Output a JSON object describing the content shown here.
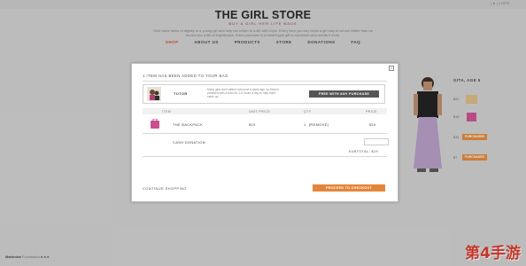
{
  "header": {
    "top_links": "| ●  |  LISTE",
    "logo_title": "THE GIRL STORE",
    "logo_subtitle": "BUY A GIRL HER LIFE BACK",
    "intro_text": "Give basic items of dignity to a young girl and help her return to a life with hope. Every item you buy helps a girl stay in school rather than be forced into a life of exploitation. Each purchase is a meaningful gift to someone who needs it most."
  },
  "nav": {
    "items": [
      "SHOP",
      "ABOUT US",
      "PRODUCTS",
      "STORE",
      "DONATIONS",
      "FAQ"
    ],
    "active_index": 0,
    "active_color": "#c4512b"
  },
  "product_side": {
    "girl_label": "GITA, AGE 5",
    "prices": [
      "$22",
      "$15",
      "$15",
      "$7"
    ],
    "badges": [
      "PURCHASED",
      "PURCHASED"
    ],
    "badge_color": "#e0883b"
  },
  "modal": {
    "added_text": "1 ITEM HAS BEEN ADDED TO YOUR BAG",
    "tutor": {
      "label": "TUTOR",
      "description": "Many girls don't attend school at a basic age, so they're provided with a tutor for 1-5 hours a day to help them catch up.",
      "free_button": "FREE WITH ANY PURCHASE"
    },
    "table": {
      "headers": [
        "ITEM",
        "UNIT PRICE",
        "QTY",
        "PRICE"
      ],
      "rows": [
        {
          "name": "THE BACKPACK",
          "unit_price": "$19",
          "qty": "1",
          "qty_actions": "[REMOVE]",
          "price": "$19"
        }
      ],
      "cash_donation_label": "CASH DONATION"
    },
    "subtotal": "SUBTOTAL: $19",
    "continue_label": "CONTINUE SHOPPING",
    "proceed_label": "PROCEED TO CHECKOUT",
    "accent_color": "#e4863a"
  },
  "footer": {
    "brand": "Mahindra",
    "text": "Foundation",
    "watermark": "第4手游"
  }
}
